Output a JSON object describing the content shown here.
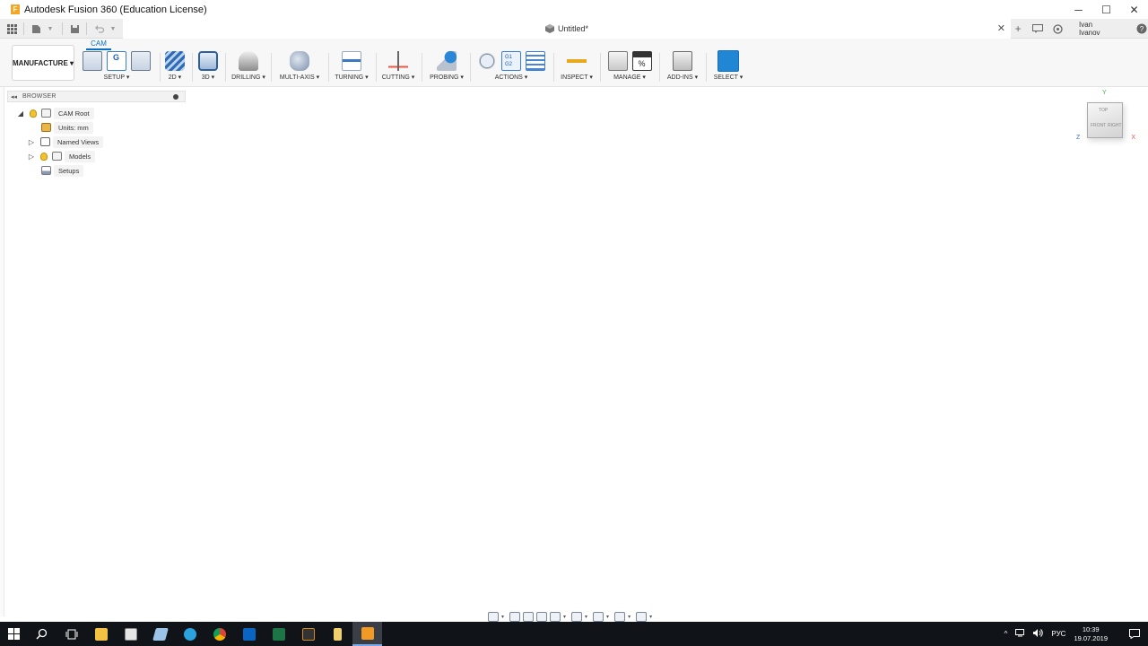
{
  "window": {
    "title": "Autodesk Fusion 360 (Education License)",
    "logo_letter": "F",
    "minimize": "─",
    "maximize": "☐",
    "close": "✕"
  },
  "tabbar": {
    "doc_title": "Untitled*",
    "close": "✕",
    "user": "Ivan Ivanov",
    "help": "?"
  },
  "ribbon": {
    "active_tab": "CAM",
    "workspace": "MANUFACTURE ▾",
    "groups": {
      "setup": "SETUP ▾",
      "2d": "2D ▾",
      "3d": "3D ▾",
      "drilling": "DRILLING ▾",
      "multiaxis": "MULTI-AXIS ▾",
      "turning": "TURNING ▾",
      "cutting": "CUTTING ▾",
      "probing": "PROBING ▾",
      "actions": "ACTIONS ▾",
      "inspect": "INSPECT ▾",
      "manage": "MANAGE ▾",
      "addins": "ADD-INS ▾",
      "select": "SELECT ▾"
    }
  },
  "browser": {
    "title": "BROWSER",
    "collapse": "◂◂",
    "items": [
      {
        "label": "CAM Root"
      },
      {
        "label": "Units: mm"
      },
      {
        "label": "Named Views"
      },
      {
        "label": "Models"
      },
      {
        "label": "Setups"
      }
    ]
  },
  "viewcube": {
    "axis_x": "X",
    "axis_y": "Y",
    "axis_z": "Z",
    "faces": {
      "top": "TOP",
      "front": "FRONT",
      "right": "RIGHT"
    }
  },
  "taskbar": {
    "tray_lang": "РУС",
    "time": "10:39",
    "date": "19.07.2019"
  }
}
